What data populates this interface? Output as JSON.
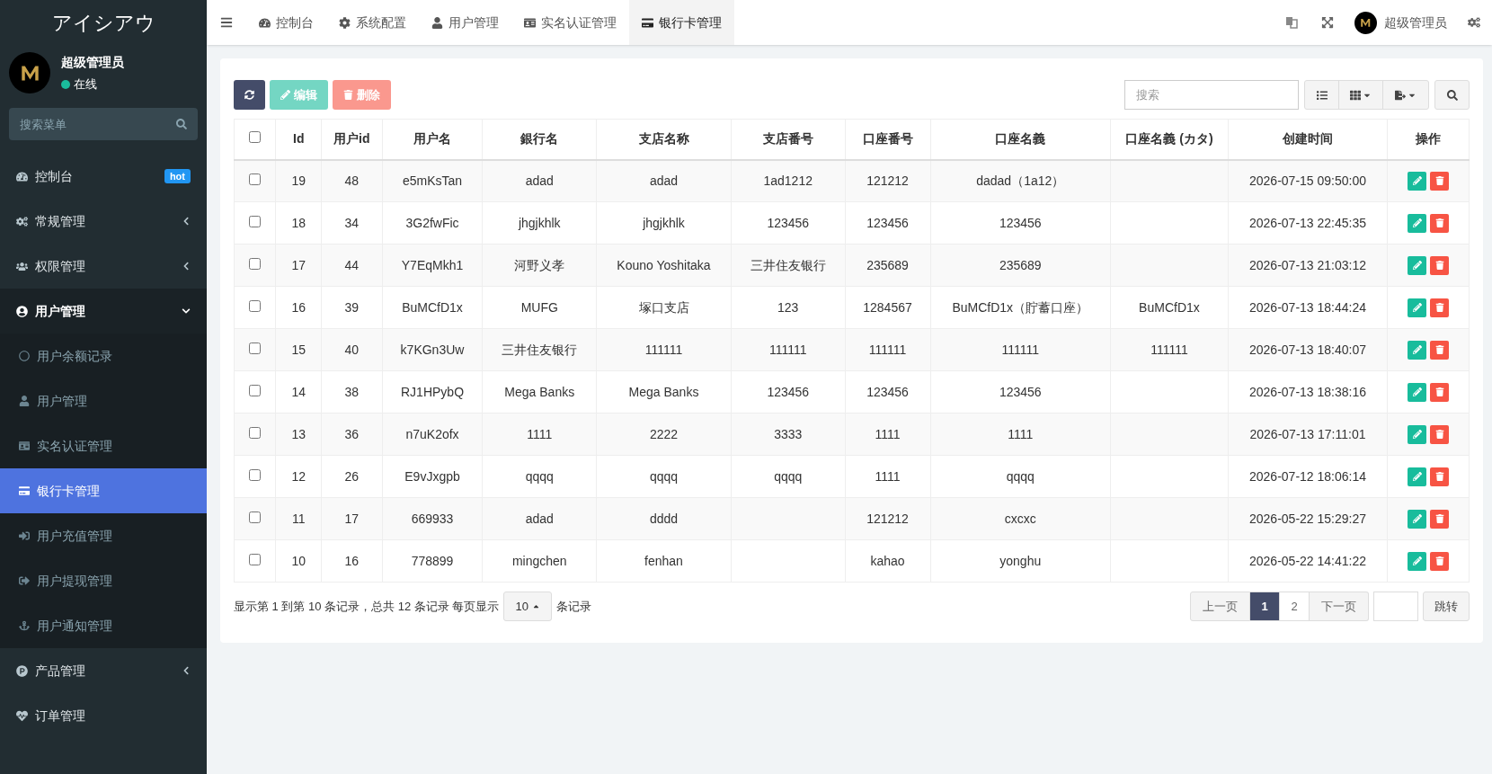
{
  "sidebar": {
    "brand": "アイシアウ",
    "user": {
      "name": "超级管理员",
      "status": "在线",
      "online": true
    },
    "search": {
      "placeholder": "搜索菜单"
    },
    "menu": [
      {
        "kind": "link",
        "label": "控制台",
        "badge": "hot"
      },
      {
        "kind": "group",
        "label": "常规管理",
        "expanded": false
      },
      {
        "kind": "group",
        "label": "权限管理",
        "expanded": false
      },
      {
        "kind": "group",
        "label": "用户管理",
        "expanded": true,
        "children": [
          {
            "label": "用户余额记录",
            "selected": false
          },
          {
            "label": "用户管理",
            "selected": false
          },
          {
            "label": "实名认证管理",
            "selected": false
          },
          {
            "label": "银行卡管理",
            "selected": true
          },
          {
            "label": "用户充值管理",
            "selected": false
          },
          {
            "label": "用户提现管理",
            "selected": false
          },
          {
            "label": "用户通知管理",
            "selected": false
          }
        ]
      },
      {
        "kind": "group",
        "label": "产品管理",
        "expanded": false
      },
      {
        "kind": "link",
        "label": "订单管理"
      }
    ]
  },
  "topbar": {
    "tabs": [
      {
        "label": "控制台",
        "selected": false
      },
      {
        "label": "系统配置",
        "selected": false
      },
      {
        "label": "用户管理",
        "selected": false
      },
      {
        "label": "实名认证管理",
        "selected": false
      },
      {
        "label": "银行卡管理",
        "selected": true
      }
    ],
    "user": "超级管理员"
  },
  "toolbar": {
    "buttons": [
      {
        "kind": "refresh",
        "disabled": false
      },
      {
        "kind": "edit",
        "label": "编辑",
        "disabled": true
      },
      {
        "kind": "delete",
        "label": "删除",
        "disabled": true
      }
    ],
    "search": {
      "placeholder": "搜索"
    }
  },
  "table": {
    "select_all_checked": false,
    "columns": [
      "Id",
      "用户id",
      "用户名",
      "銀行名",
      "支店名称",
      "支店番号",
      "口座番号",
      "口座名義",
      "口座名義 (カタ)",
      "创建时间",
      "操作"
    ],
    "rows": [
      {
        "checked": false,
        "cells": [
          "19",
          "48",
          "e5mKsTan",
          "adad",
          "adad",
          "1ad1212",
          "121212",
          "dadad（1a12）",
          "",
          "2026-07-15 09:50:00"
        ]
      },
      {
        "checked": false,
        "cells": [
          "18",
          "34",
          "3G2fwFic",
          "jhgjkhlk",
          "jhgjkhlk",
          "123456",
          "123456",
          "123456",
          "",
          "2026-07-13 22:45:35"
        ]
      },
      {
        "checked": false,
        "cells": [
          "17",
          "44",
          "Y7EqMkh1",
          "河野义孝",
          "Kouno Yoshitaka",
          "三井住友银行",
          "235689",
          "235689",
          "",
          "2026-07-13 21:03:12"
        ]
      },
      {
        "checked": false,
        "cells": [
          "16",
          "39",
          "BuMCfD1x",
          "MUFG",
          "塚口支店",
          "123",
          "1284567",
          "BuMCfD1x（貯蓄口座）",
          "BuMCfD1x",
          "2026-07-13 18:44:24"
        ]
      },
      {
        "checked": false,
        "cells": [
          "15",
          "40",
          "k7KGn3Uw",
          "三井住友银行",
          "111111",
          "111111",
          "111111",
          "111111",
          "111111",
          "2026-07-13 18:40:07"
        ]
      },
      {
        "checked": false,
        "cells": [
          "14",
          "38",
          "RJ1HPybQ",
          "Mega Banks",
          "Mega Banks",
          "123456",
          "123456",
          "123456",
          "",
          "2026-07-13 18:38:16"
        ]
      },
      {
        "checked": false,
        "cells": [
          "13",
          "36",
          "n7uK2ofx",
          "1111",
          "2222",
          "3333",
          "1111",
          "1111",
          "",
          "2026-07-13 17:11:01"
        ]
      },
      {
        "checked": false,
        "cells": [
          "12",
          "26",
          "E9vJxgpb",
          "qqqq",
          "qqqq",
          "qqqq",
          "1111",
          "qqqq",
          "",
          "2026-07-12 18:06:14"
        ]
      },
      {
        "checked": false,
        "cells": [
          "11",
          "17",
          "669933",
          "adad",
          "dddd",
          "",
          "121212",
          "cxcxc",
          "",
          "2026-05-22 15:29:27"
        ]
      },
      {
        "checked": false,
        "cells": [
          "10",
          "16",
          "778899",
          "mingchen",
          "fenhan",
          "",
          "kahao",
          "yonghu",
          "",
          "2026-05-22 14:41:22"
        ]
      }
    ]
  },
  "footer": {
    "info": "显示第 1 到第 10 条记录，总共 12 条记录 每页显示",
    "page_size": "10",
    "suffix": "条记录",
    "pagination": {
      "prev": "上一页",
      "pages": [
        {
          "label": "1",
          "selected": true
        },
        {
          "label": "2",
          "selected": false
        }
      ],
      "next": "下一页",
      "jump": "跳转"
    }
  }
}
